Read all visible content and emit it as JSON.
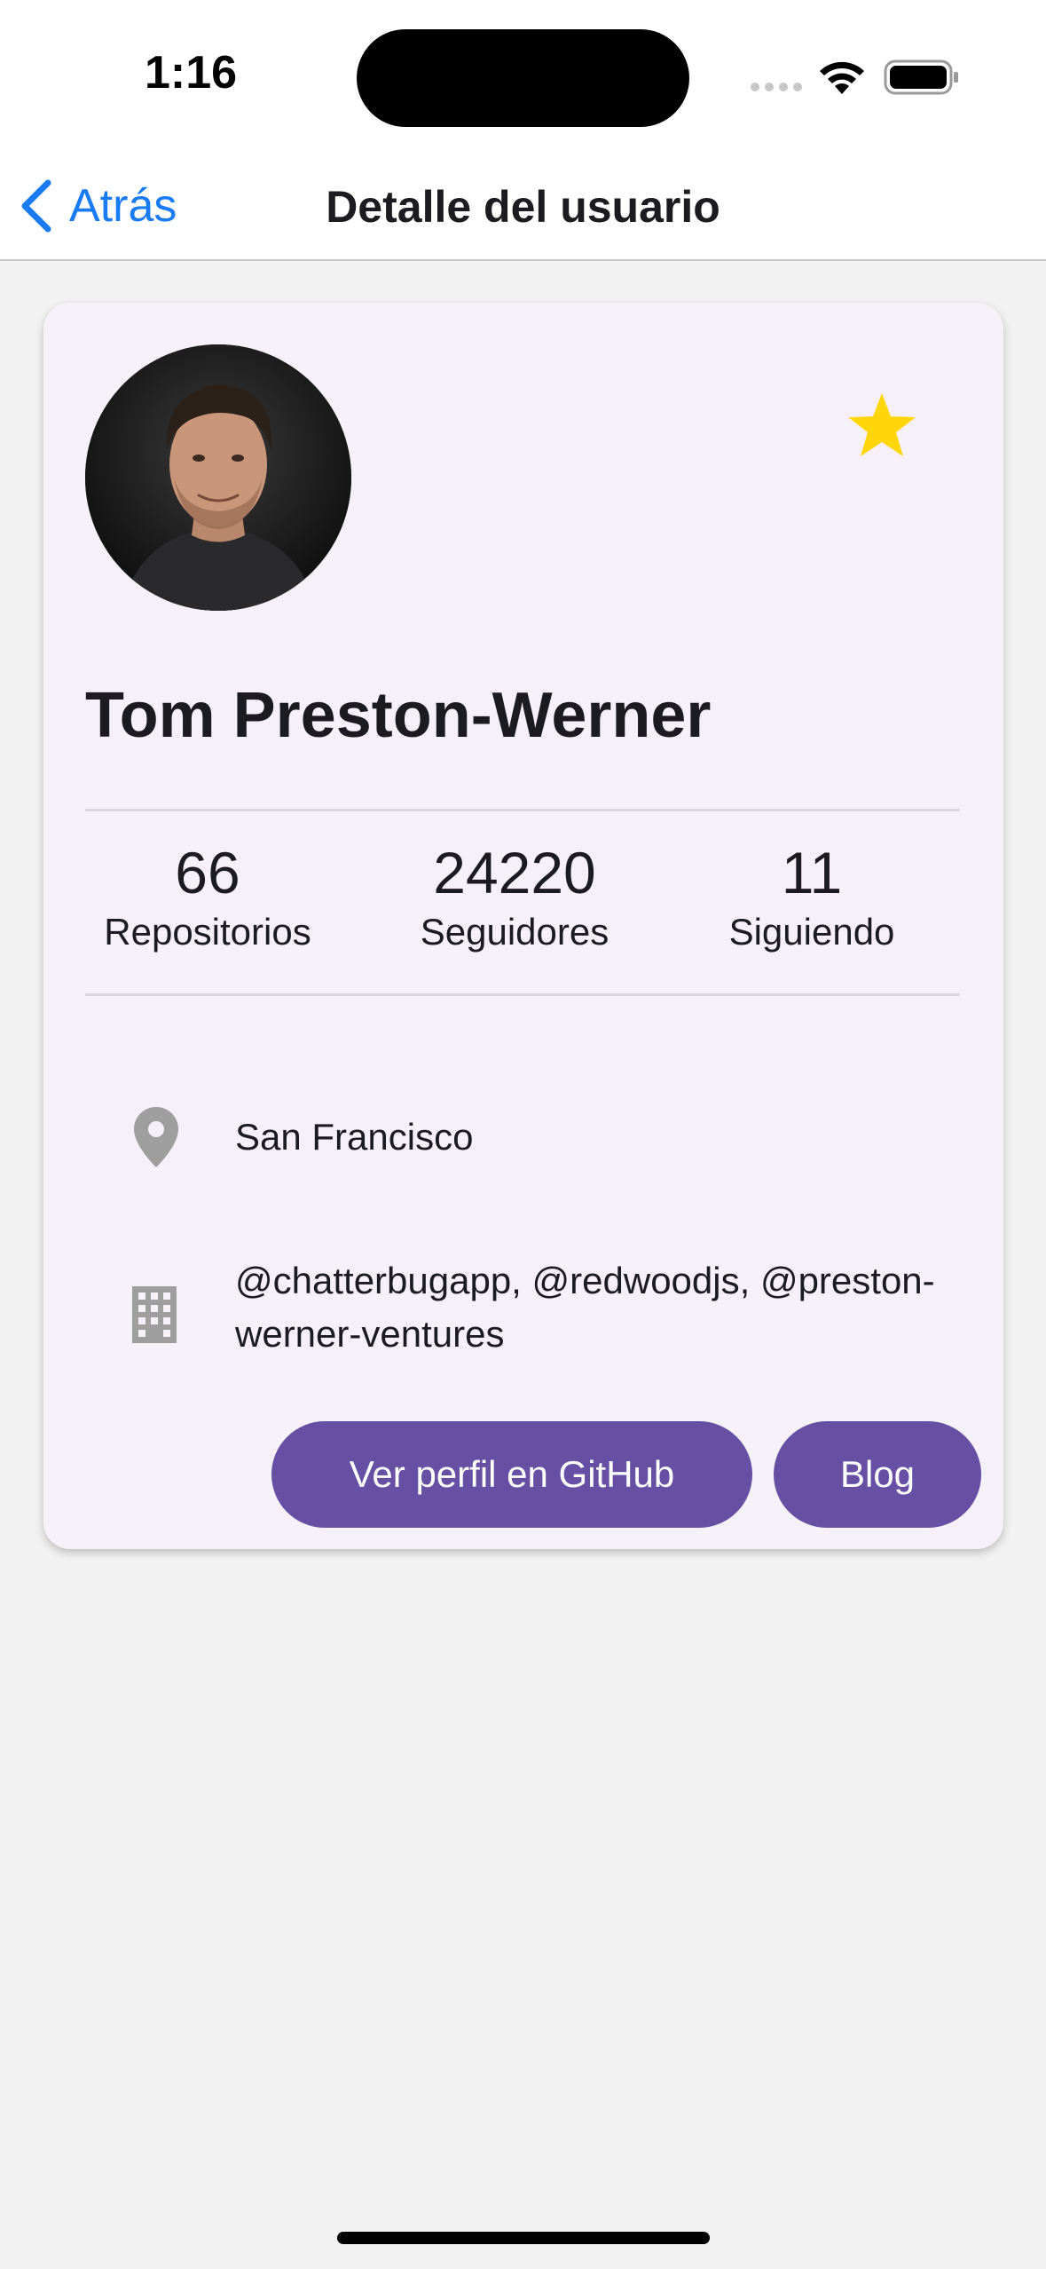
{
  "status_bar": {
    "time": "1:16"
  },
  "nav": {
    "back_label": "Atrás",
    "title": "Detalle del usuario"
  },
  "profile": {
    "name": "Tom Preston-Werner",
    "favorite": true,
    "stats": [
      {
        "value": "66",
        "label": "Repositorios"
      },
      {
        "value": "24220",
        "label": "Seguidores"
      },
      {
        "value": "11",
        "label": "Siguiendo"
      }
    ],
    "location": "San Francisco",
    "company_line1": "@chatterbugapp, @redwoodjs, @preston-",
    "company_line2": "werner-ventures"
  },
  "actions": {
    "github_label": "Ver perfil en GitHub",
    "blog_label": "Blog"
  },
  "colors": {
    "accent": "#1a7cf5",
    "primary": "#6750a4",
    "star": "#ffd60a",
    "card_background": "#f6f1f8",
    "icon_gray": "#9e9e9e"
  },
  "icons": {
    "back": "chevron-left-icon",
    "favorite": "star-icon",
    "location": "location-pin-icon",
    "company": "building-icon"
  }
}
